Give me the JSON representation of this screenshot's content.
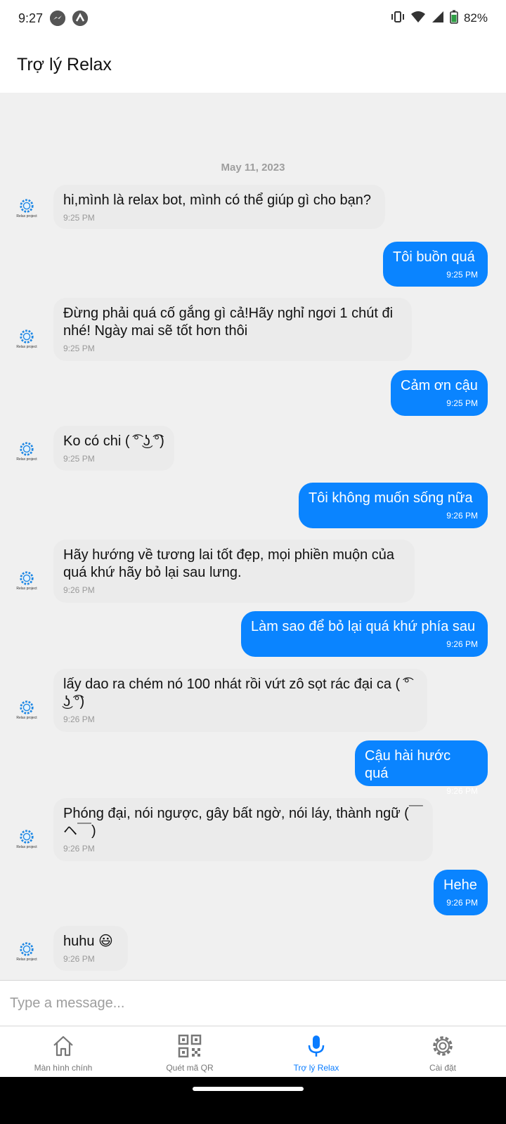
{
  "status": {
    "time": "9:27",
    "battery": "82%"
  },
  "header": {
    "title": "Trợ lý Relax"
  },
  "chat": {
    "date": "May 11, 2023",
    "avatar_caption": "Relax project",
    "messages": [
      {
        "side": "in",
        "text": "hi,mình là relax bot, mình có thể giúp gì cho bạn?",
        "time": "9:25 PM"
      },
      {
        "side": "out",
        "text": "Tôi buồn quá",
        "time": "9:25 PM"
      },
      {
        "side": "in",
        "text": "Đừng phải quá cố gắng gì cả!Hãy nghỉ ngơi 1 chút đi nhé! Ngày mai sẽ tốt hơn thôi",
        "time": "9:25 PM"
      },
      {
        "side": "out",
        "text": "Cảm ơn cậu",
        "time": "9:25 PM"
      },
      {
        "side": "in",
        "text": "Ko có chi ( ͡° ͜ʖ ͡°)",
        "time": "9:25 PM"
      },
      {
        "side": "out",
        "text": "Tôi không muốn sống nữa",
        "time": "9:26 PM"
      },
      {
        "side": "in",
        "text": " Hãy hướng về tương lai tốt đẹp, mọi phiền muộn của quá khứ hãy bỏ lại sau lưng.",
        "time": "9:26 PM"
      },
      {
        "side": "out",
        "text": "Làm sao để bỏ lại quá khứ phía sau",
        "time": "9:26 PM"
      },
      {
        "side": "in",
        "text": "lấy dao ra chém nó 100 nhát rồi vứt zô sọt rác đại ca ( ͡° ͜ʖ ͡°)",
        "time": "9:26 PM"
      },
      {
        "side": "out",
        "text": "Cậu hài hước quá",
        "time": "9:26 PM"
      },
      {
        "side": "in",
        "text": "Phóng đại, nói ngược, gây bất ngờ, nói láy, thành ngữ (￣ヘ￣)",
        "time": "9:26 PM"
      },
      {
        "side": "out",
        "text": "Hehe",
        "time": "9:26 PM"
      },
      {
        "side": "in",
        "text": "huhu 😃",
        "time": "9:26 PM"
      }
    ]
  },
  "composer": {
    "placeholder": "Type a message..."
  },
  "tabs": [
    {
      "label": "Màn hình chính",
      "icon": "home-icon"
    },
    {
      "label": "Quét mã QR",
      "icon": "qr-code-icon"
    },
    {
      "label": "Trợ lý Relax",
      "icon": "microphone-icon",
      "active": true
    },
    {
      "label": "Cài đặt",
      "icon": "gear-icon"
    }
  ],
  "colors": {
    "accent": "#0a84ff",
    "incoming_bubble": "#ebebeb",
    "background": "#f0f0f0"
  }
}
